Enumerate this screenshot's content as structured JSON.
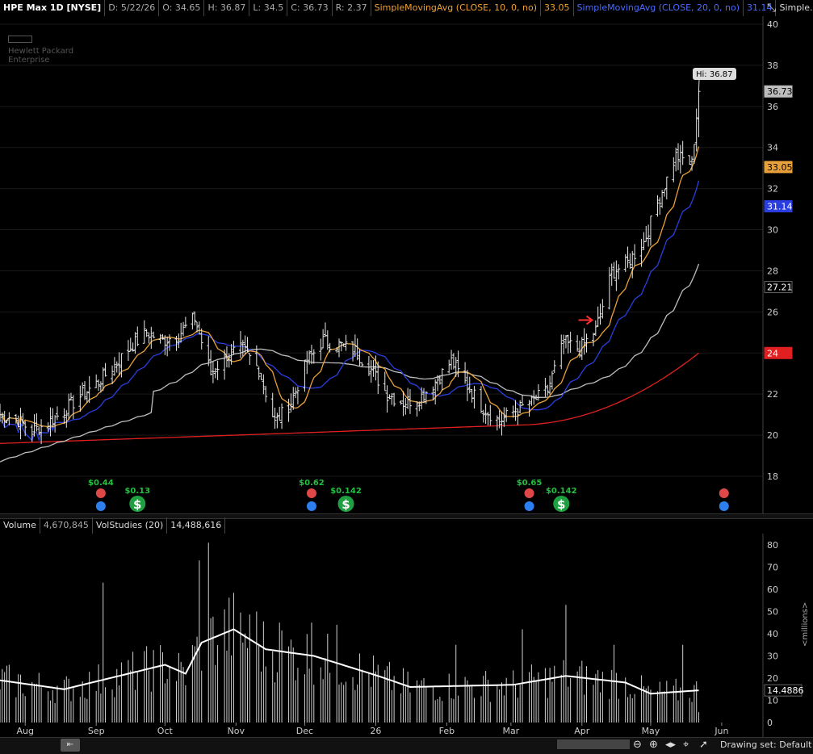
{
  "header": {
    "symbol": "HPE Max 1D [NYSE]",
    "date": "D: 5/22/26",
    "open": "O: 34.65",
    "high": "H: 36.87",
    "low": "L: 34.5",
    "close": "C: 36.73",
    "range": "R: 2.37",
    "sma10_label": "SimpleMovingAvg (CLOSE, 10, 0, no)",
    "sma10_value": "33.05",
    "sma20_label": "SimpleMovingAvg (CLOSE, 20, 0, no)",
    "sma20_value": "31.14",
    "more_label": "Simple..."
  },
  "logo": {
    "line1": "Hewlett Packard",
    "line2": "Enterprise"
  },
  "price_axis": {
    "ticks": [
      "40",
      "38",
      "36",
      "34",
      "32",
      "30",
      "28",
      "26",
      "24",
      "22",
      "20",
      "18"
    ],
    "badges": [
      {
        "text": "36.73",
        "value": 36.73,
        "color": "#bdbdbd",
        "fg": "#000"
      },
      {
        "text": "33.05",
        "value": 33.05,
        "color": "#e8a13a",
        "fg": "#000"
      },
      {
        "text": "31.14",
        "value": 31.14,
        "color": "#2a3ee0",
        "fg": "#fff"
      },
      {
        "text": "27.21",
        "value": 27.21,
        "color": "#000",
        "fg": "#fff"
      },
      {
        "text": "24",
        "value": 24.0,
        "color": "#e02020",
        "fg": "#fff"
      }
    ],
    "hi_label": "Hi: 36.87"
  },
  "events": [
    {
      "date": "2025-09-03",
      "type": "earnings",
      "amount": "$0.44"
    },
    {
      "date": "2025-09-19",
      "type": "dividend",
      "amount": "$0.13"
    },
    {
      "date": "2025-12-04",
      "type": "earnings",
      "amount": "$0.62"
    },
    {
      "date": "2025-12-19",
      "type": "dividend",
      "amount": "$0.142"
    },
    {
      "date": "2026-03-09",
      "type": "earnings",
      "amount": "$0.65"
    },
    {
      "date": "2026-03-23",
      "type": "dividend",
      "amount": "$0.142"
    },
    {
      "date": "2026-06-02",
      "type": "earnings",
      "amount": ""
    }
  ],
  "volume_header": {
    "label": "Volume",
    "value": "4,670,845",
    "study_label": "VolStudies (20)",
    "study_value": "14,488,616"
  },
  "volume_axis": {
    "ticks": [
      "80",
      "70",
      "60",
      "50",
      "40",
      "30",
      "20",
      "10",
      "0"
    ],
    "unit": "<millions>",
    "badge": "14.4886"
  },
  "x_axis": {
    "labels": [
      "Aug",
      "Sep",
      "Oct",
      "Nov",
      "Dec",
      "26",
      "Feb",
      "Mar",
      "Apr",
      "May",
      "Jun"
    ]
  },
  "footer": {
    "drawing_set": "Drawing set: Default"
  },
  "chart_data": {
    "type": "candlestick",
    "symbol": "HPE",
    "period": "1D",
    "date_range": [
      "2025-07-21",
      "2026-05-22"
    ],
    "ylim": [
      17,
      40
    ],
    "last": {
      "open": 34.65,
      "high": 36.87,
      "low": 34.5,
      "close": 36.73
    },
    "close_anchors": [
      {
        "d": "2025-07-21",
        "c": 21.0
      },
      {
        "d": "2025-07-28",
        "c": 20.8
      },
      {
        "d": "2025-08-04",
        "c": 20.2
      },
      {
        "d": "2025-08-11",
        "c": 20.6
      },
      {
        "d": "2025-08-18",
        "c": 21.2
      },
      {
        "d": "2025-08-25",
        "c": 21.9
      },
      {
        "d": "2025-09-02",
        "c": 22.6
      },
      {
        "d": "2025-09-09",
        "c": 23.4
      },
      {
        "d": "2025-09-16",
        "c": 24.3
      },
      {
        "d": "2025-09-23",
        "c": 25.0
      },
      {
        "d": "2025-09-30",
        "c": 24.6
      },
      {
        "d": "2025-10-07",
        "c": 24.9
      },
      {
        "d": "2025-10-14",
        "c": 25.7
      },
      {
        "d": "2025-10-21",
        "c": 23.0
      },
      {
        "d": "2025-10-28",
        "c": 23.9
      },
      {
        "d": "2025-11-04",
        "c": 24.2
      },
      {
        "d": "2025-11-11",
        "c": 23.2
      },
      {
        "d": "2025-11-18",
        "c": 20.6
      },
      {
        "d": "2025-11-25",
        "c": 21.6
      },
      {
        "d": "2025-12-02",
        "c": 23.6
      },
      {
        "d": "2025-12-09",
        "c": 24.6
      },
      {
        "d": "2025-12-16",
        "c": 24.4
      },
      {
        "d": "2025-12-23",
        "c": 24.1
      },
      {
        "d": "2025-12-30",
        "c": 23.2
      },
      {
        "d": "2026-01-06",
        "c": 22.0
      },
      {
        "d": "2026-01-13",
        "c": 21.6
      },
      {
        "d": "2026-01-20",
        "c": 21.8
      },
      {
        "d": "2026-01-27",
        "c": 22.6
      },
      {
        "d": "2026-02-03",
        "c": 23.6
      },
      {
        "d": "2026-02-10",
        "c": 22.4
      },
      {
        "d": "2026-02-17",
        "c": 21.3
      },
      {
        "d": "2026-02-24",
        "c": 20.7
      },
      {
        "d": "2026-03-03",
        "c": 21.2
      },
      {
        "d": "2026-03-10",
        "c": 21.6
      },
      {
        "d": "2026-03-17",
        "c": 22.2
      },
      {
        "d": "2026-03-24",
        "c": 24.5
      },
      {
        "d": "2026-03-31",
        "c": 24.2
      },
      {
        "d": "2026-04-07",
        "c": 25.1
      },
      {
        "d": "2026-04-14",
        "c": 27.9
      },
      {
        "d": "2026-04-21",
        "c": 28.4
      },
      {
        "d": "2026-04-28",
        "c": 29.4
      },
      {
        "d": "2026-05-05",
        "c": 31.6
      },
      {
        "d": "2026-05-12",
        "c": 33.6
      },
      {
        "d": "2026-05-19",
        "c": 33.2
      },
      {
        "d": "2026-05-22",
        "c": 36.73
      }
    ],
    "series": [
      {
        "name": "SimpleMovingAvg (CLOSE, 10, 0, no)",
        "last": 33.05,
        "color": "#e8a13a"
      },
      {
        "name": "SimpleMovingAvg (CLOSE, 20, 0, no)",
        "last": 31.14,
        "color": "#2a3ee0"
      },
      {
        "name": "",
        "last": 27.21,
        "color": "#bdbdbd"
      },
      {
        "name": "",
        "last": 24.0,
        "color": "#e02020"
      }
    ],
    "volume": {
      "unit": "millions",
      "ylim": [
        0,
        85
      ],
      "last": 4.670845,
      "vol_avg_last": 14.4886,
      "anchors_avg": [
        {
          "d": "2025-07-21",
          "v": 19
        },
        {
          "d": "2025-08-18",
          "v": 15
        },
        {
          "d": "2025-09-15",
          "v": 22
        },
        {
          "d": "2025-10-01",
          "v": 26
        },
        {
          "d": "2025-10-10",
          "v": 22
        },
        {
          "d": "2025-10-17",
          "v": 36
        },
        {
          "d": "2025-10-31",
          "v": 42
        },
        {
          "d": "2025-11-14",
          "v": 33
        },
        {
          "d": "2025-12-05",
          "v": 30
        },
        {
          "d": "2026-01-02",
          "v": 21
        },
        {
          "d": "2026-01-16",
          "v": 16
        },
        {
          "d": "2026-03-02",
          "v": 17
        },
        {
          "d": "2026-03-25",
          "v": 21
        },
        {
          "d": "2026-04-20",
          "v": 18
        },
        {
          "d": "2026-05-01",
          "v": 13
        },
        {
          "d": "2026-05-22",
          "v": 14.5
        }
      ],
      "spikes": [
        {
          "d": "2025-09-04",
          "v": 63
        },
        {
          "d": "2025-10-16",
          "v": 73
        },
        {
          "d": "2025-10-20",
          "v": 81
        },
        {
          "d": "2025-11-10",
          "v": 50
        },
        {
          "d": "2025-11-20",
          "v": 45
        },
        {
          "d": "2025-12-04",
          "v": 45
        },
        {
          "d": "2025-12-15",
          "v": 44
        },
        {
          "d": "2026-02-05",
          "v": 35
        },
        {
          "d": "2026-03-06",
          "v": 42
        },
        {
          "d": "2026-03-25",
          "v": 53
        },
        {
          "d": "2026-04-15",
          "v": 35
        },
        {
          "d": "2026-05-15",
          "v": 35
        }
      ]
    }
  }
}
